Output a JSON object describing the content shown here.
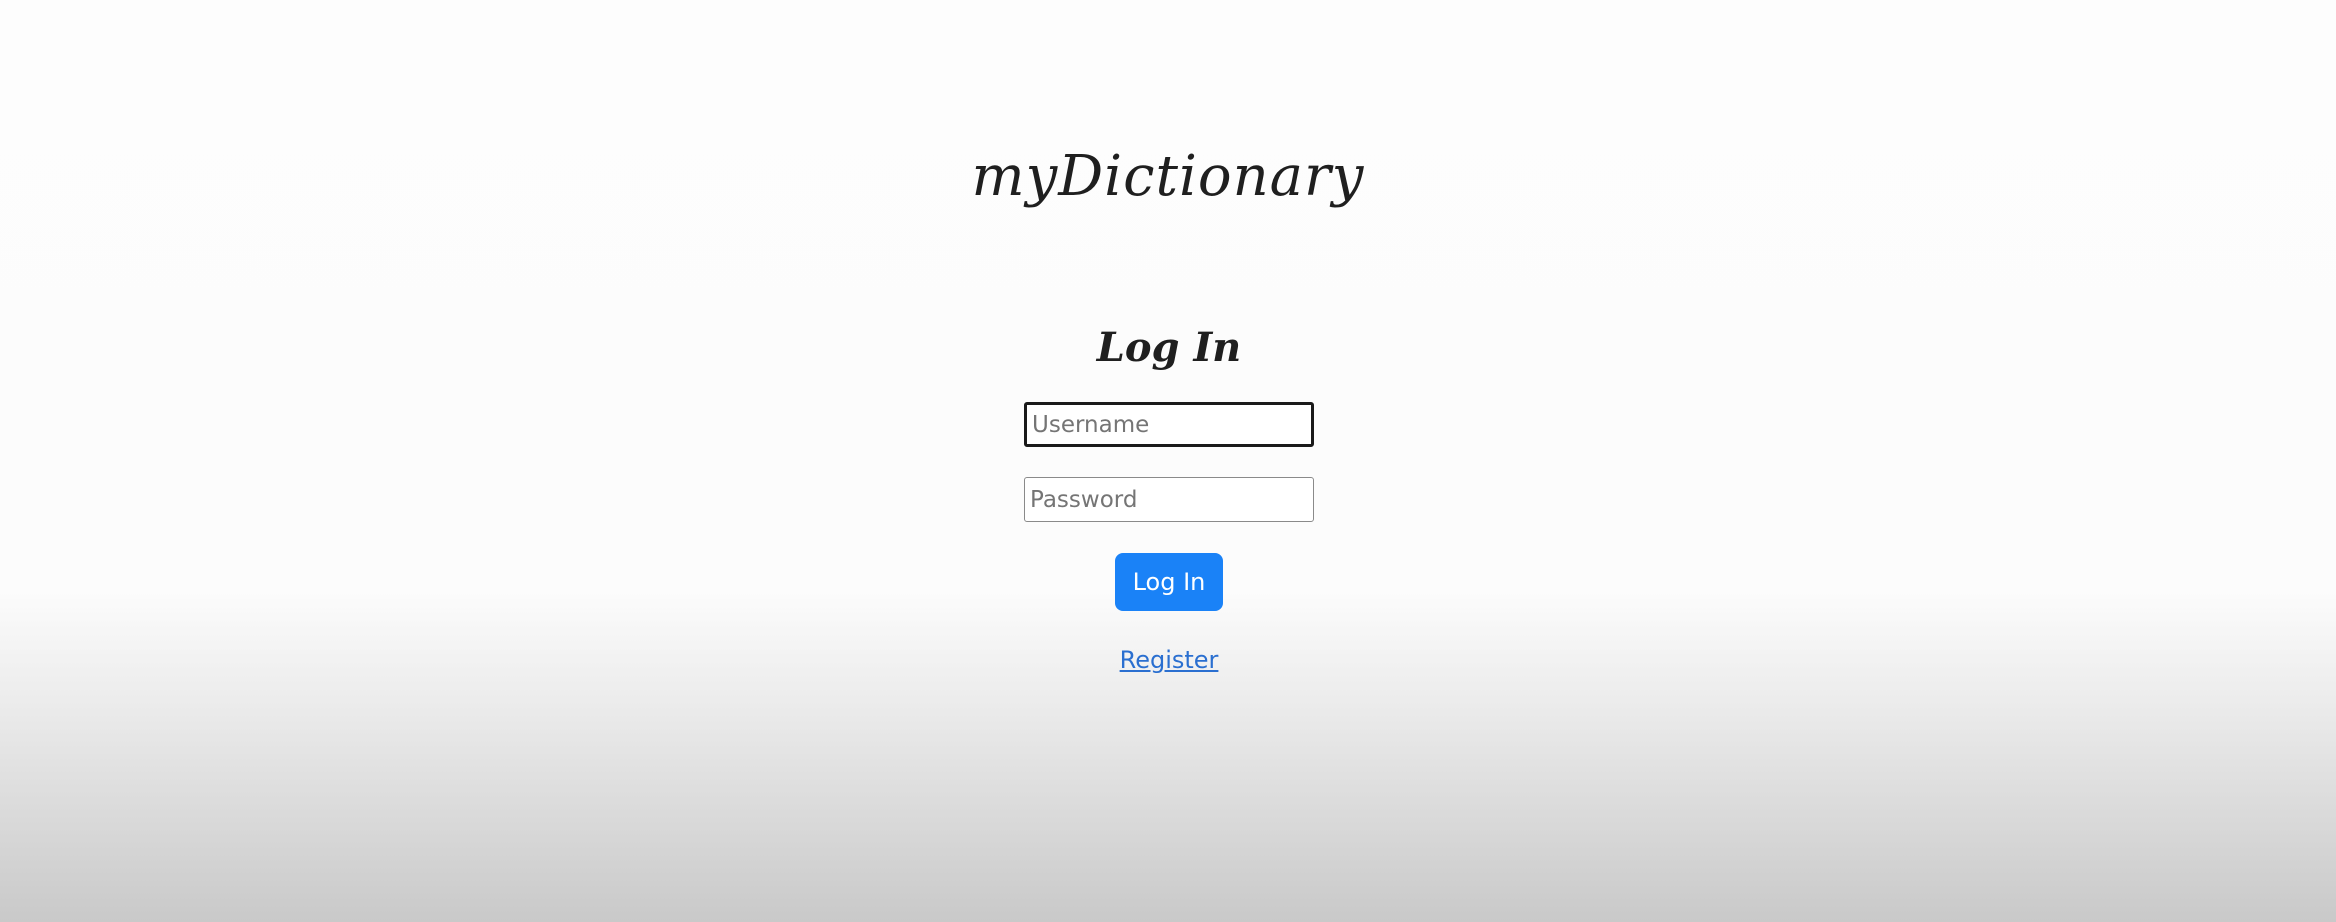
{
  "app": {
    "title": "myDictionary"
  },
  "login": {
    "heading": "Log In",
    "username_placeholder": "Username",
    "password_placeholder": "Password",
    "submit_label": "Log In",
    "register_link": "Register"
  },
  "colors": {
    "primary_button": "#1a82f7",
    "link": "#2a6fd0",
    "text": "#1f1f1f"
  }
}
